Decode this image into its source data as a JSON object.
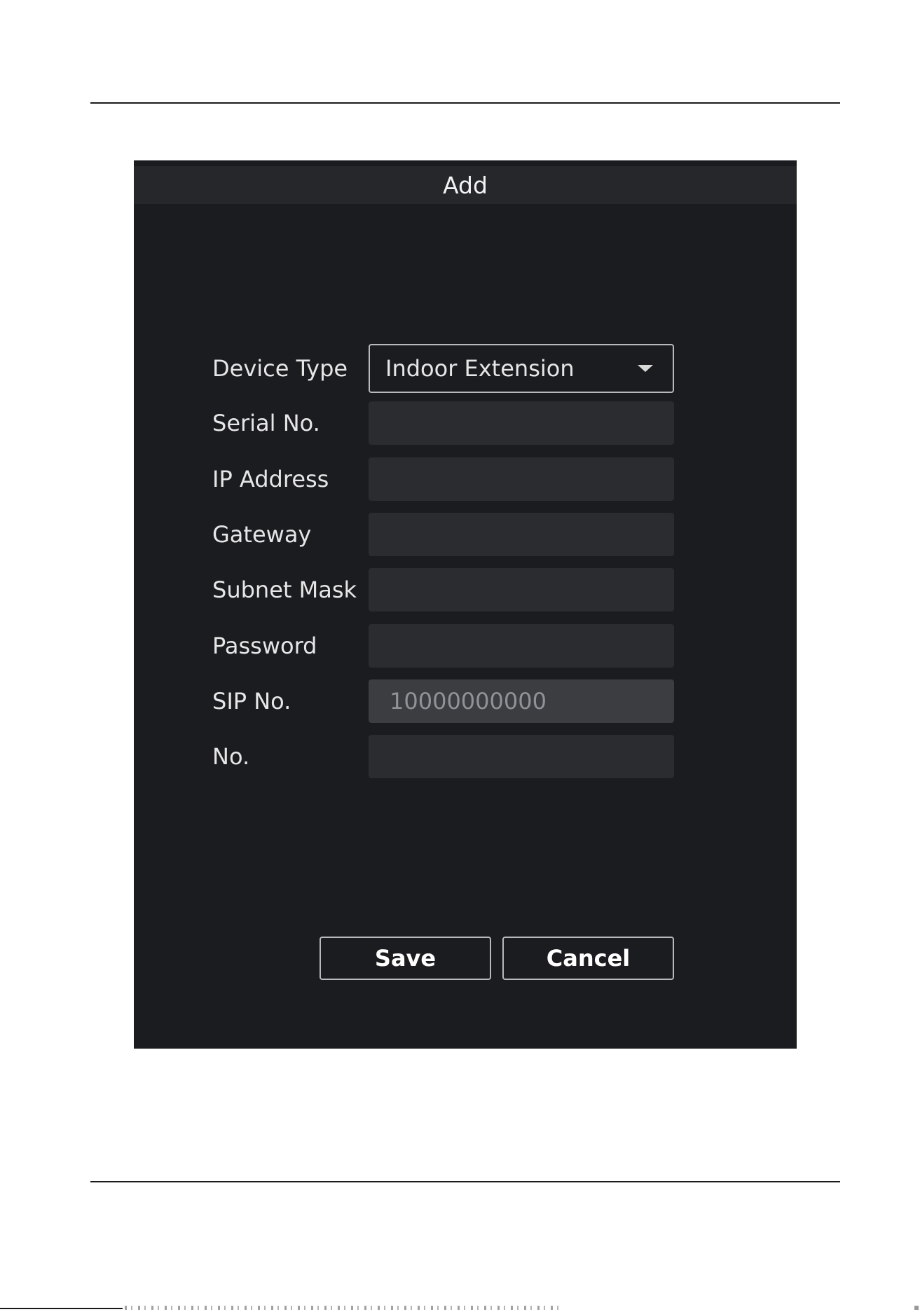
{
  "dialog": {
    "title": "Add",
    "fields": {
      "device_type": {
        "label": "Device Type",
        "value": "Indoor Extension"
      },
      "serial_no": {
        "label": "Serial No.",
        "value": ""
      },
      "ip_address": {
        "label": "IP Address",
        "value": ""
      },
      "gateway": {
        "label": "Gateway",
        "value": ""
      },
      "subnet_mask": {
        "label": "Subnet Mask",
        "value": ""
      },
      "password": {
        "label": "Password",
        "value": ""
      },
      "sip_no": {
        "label": "SIP No.",
        "value": "10000000000"
      },
      "no": {
        "label": "No.",
        "value": ""
      }
    },
    "buttons": {
      "save": "Save",
      "cancel": "Cancel"
    }
  },
  "colors": {
    "dialog_background": "#1a1c1f",
    "header_background": "#25272b",
    "input_background": "#2a2c30",
    "disabled_input_background": "#3b3d41",
    "border": "#b8b9bb",
    "text": "#e6e6e6"
  },
  "icons": {
    "device_type_dropdown": "caret-down-icon"
  }
}
